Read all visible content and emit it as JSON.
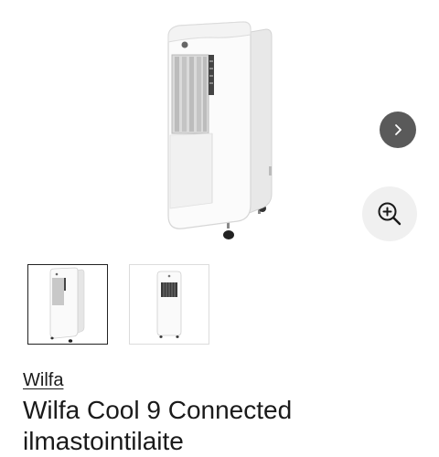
{
  "product": {
    "brand": "Wilfa",
    "title": "Wilfa Cool 9 Connected ilmastointilaite",
    "main_image_alt": "Wilfa Cool 9 Connected ilmastointilaite",
    "thumbnails": [
      {
        "view": "side",
        "selected": true
      },
      {
        "view": "front",
        "selected": false
      }
    ]
  },
  "controls": {
    "next_icon": "chevron-right-icon",
    "zoom_icon": "zoom-in-icon"
  },
  "colors": {
    "nav_button": "#5a5a5a",
    "zoom_button": "#f0f0f0",
    "text": "#1a1a1a",
    "selected_thumb_border": "#222222"
  }
}
